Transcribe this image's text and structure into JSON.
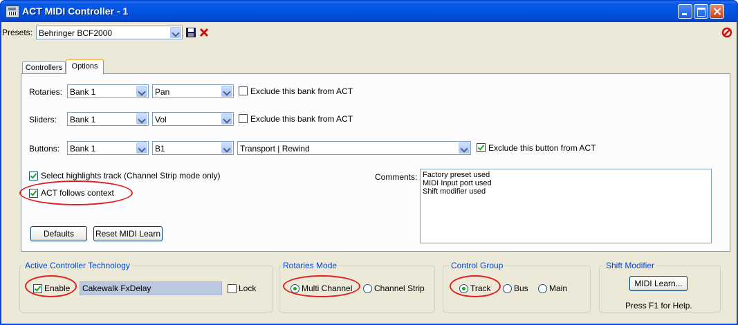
{
  "window": {
    "title": "ACT MIDI Controller - 1"
  },
  "presets": {
    "label": "Presets:",
    "value": "Behringer BCF2000"
  },
  "tabs": [
    {
      "label": "Controllers"
    },
    {
      "label": "Options"
    }
  ],
  "rows": {
    "rotaries": {
      "label": "Rotaries:",
      "bank": "Bank 1",
      "param": "Pan",
      "exclude_label": "Exclude this bank from ACT",
      "exclude_checked": false
    },
    "sliders": {
      "label": "Sliders:",
      "bank": "Bank 1",
      "param": "Vol",
      "exclude_label": "Exclude this bank from ACT",
      "exclude_checked": false
    },
    "buttons": {
      "label": "Buttons:",
      "bank": "Bank 1",
      "param": "B1",
      "action": "Transport | Rewind",
      "exclude_label": "Exclude this button from ACT",
      "exclude_checked": true
    }
  },
  "options": {
    "select_highlights": {
      "label": "Select highlights track (Channel Strip mode only)",
      "checked": true
    },
    "act_follows_context": {
      "label": "ACT follows context",
      "checked": true
    }
  },
  "comments": {
    "label": "Comments:",
    "lines": [
      "Factory preset used",
      "MIDI Input port used",
      "Shift modifier used"
    ]
  },
  "buttons": {
    "defaults": "Defaults",
    "reset_midi_learn": "Reset MIDI Learn",
    "midi_learn": "MIDI Learn..."
  },
  "act_group": {
    "title": "Active Controller Technology",
    "enable_label": "Enable",
    "enable_checked": true,
    "plugin": "Cakewalk FxDelay",
    "lock_label": "Lock",
    "lock_checked": false
  },
  "rotaries_mode": {
    "title": "Rotaries Mode",
    "options": [
      "Multi Channel",
      "Channel Strip"
    ],
    "selected": "Multi Channel"
  },
  "control_group": {
    "title": "Control Group",
    "options": [
      "Track",
      "Bus",
      "Main"
    ],
    "selected": "Track"
  },
  "shift_modifier": {
    "title": "Shift Modifier",
    "help": "Press F1 for Help."
  },
  "colors": {
    "annotation": "#e02020",
    "group_title": "#0046d5",
    "titlebar": "#0053e0"
  },
  "icons": [
    "save-icon",
    "delete-icon",
    "no-entry-icon",
    "app-icon"
  ]
}
